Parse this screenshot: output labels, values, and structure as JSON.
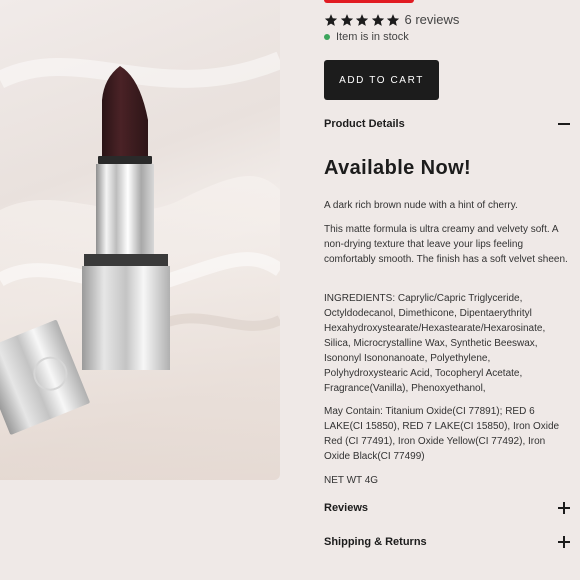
{
  "rating": {
    "stars": 5,
    "reviews_label": "6 reviews"
  },
  "stock": {
    "label": "Item is in stock"
  },
  "cart": {
    "add_label": "ADD TO CART"
  },
  "product_details": {
    "label": "Product Details",
    "heading": "Available Now!",
    "p1": "A dark rich brown nude with a hint of cherry.",
    "p2": "This matte formula is ultra creamy and velvety soft. A non-drying texture that leave your lips feeling comfortably smooth. The finish has a soft velvet sheen.",
    "p3": "INGREDIENTS: Caprylic/Capric Triglyceride, Octyldodecanol, Dimethicone, Dipentaerythrityl Hexahydroxystearate/Hexastearate/Hexarosinate, Silica, Microcrystalline Wax, Synthetic Beeswax, Isononyl Isononanoate, Polyethylene, Polyhydroxystearic Acid, Tocopheryl Acetate, Fragrance(Vanilla), Phenoxyethanol,",
    "p4": "May Contain: Titanium Oxide(CI 77891); RED 6 LAKE(CI 15850), RED 7 LAKE(CI 15850), Iron Oxide Red (CI 77491), Iron Oxide Yellow(CI 77492), Iron Oxide Black(CI 77499)",
    "p5": "NET WT 4G"
  },
  "reviews": {
    "label": "Reviews"
  },
  "shipping": {
    "label": "Shipping & Returns"
  },
  "colors": {
    "button": "#1c1c1c",
    "stock_dot": "#3ca55c",
    "badge": "#e11b22",
    "background": "#efe9e7"
  },
  "icons": {
    "star": "star-icon",
    "minus": "minus-icon",
    "plus": "plus-icon"
  }
}
